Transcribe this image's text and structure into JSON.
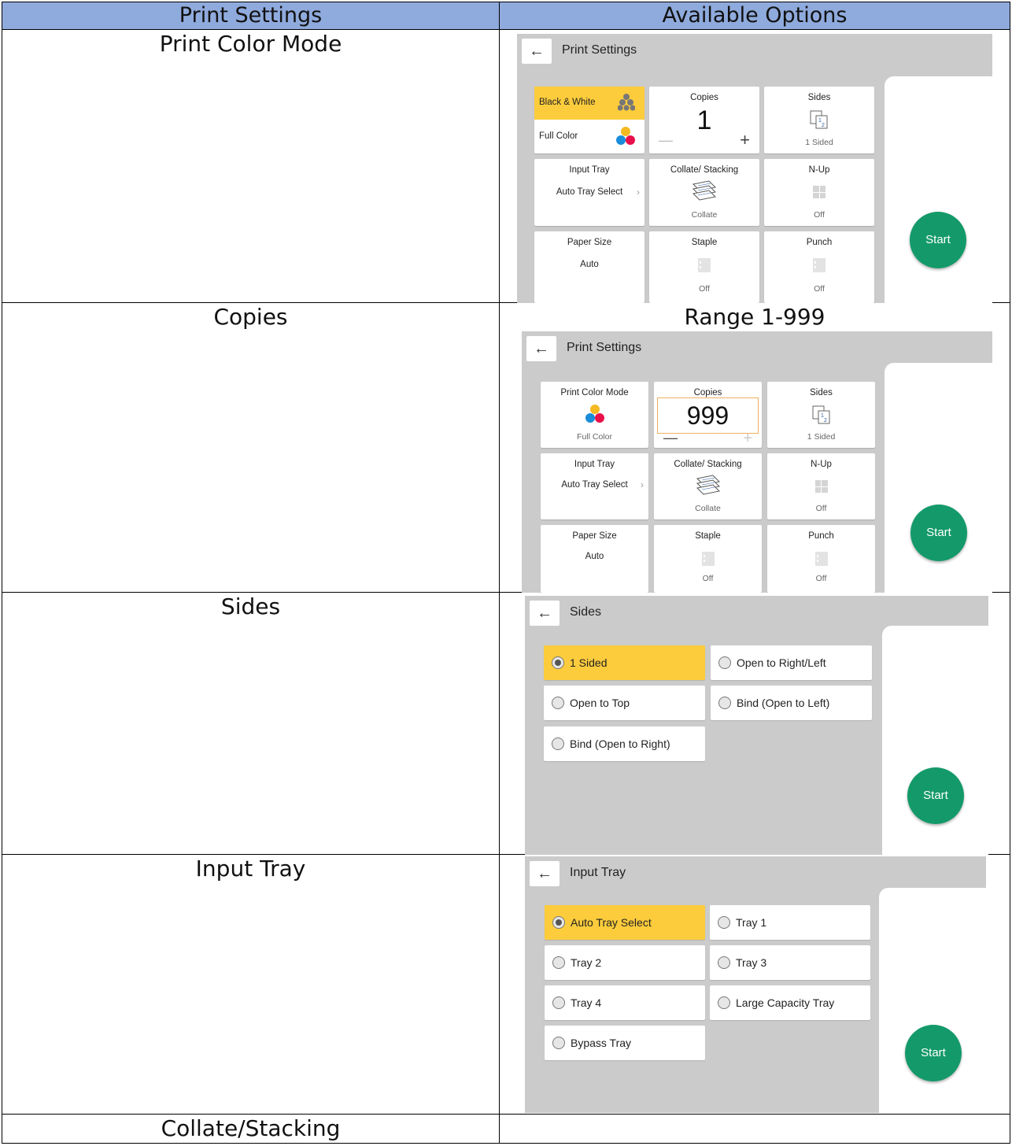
{
  "table": {
    "headers": [
      "Print Settings",
      "Available Options"
    ],
    "rows": [
      {
        "label": "Print Color Mode",
        "note": ""
      },
      {
        "label": "Copies",
        "note": "Range 1-999"
      },
      {
        "label": "Sides",
        "note": ""
      },
      {
        "label": "Input Tray",
        "note": ""
      },
      {
        "label": "Collate/Stacking",
        "note": ""
      }
    ]
  },
  "panel1": {
    "title": "Print Settings",
    "color_options": [
      "Black & White",
      "Full Color"
    ],
    "copies_label": "Copies",
    "copies_value": "1",
    "sides_label": "Sides",
    "sides_value": "1 Sided",
    "input_tray_label": "Input Tray",
    "input_tray_value": "Auto Tray Select",
    "collate_label": "Collate/ Stacking",
    "collate_value": "Collate",
    "nup_label": "N-Up",
    "nup_value": "Off",
    "paper_label": "Paper Size",
    "paper_value": "Auto",
    "staple_label": "Staple",
    "staple_value": "Off",
    "punch_label": "Punch",
    "punch_value": "Off",
    "start": "Start"
  },
  "panel2": {
    "title": "Print Settings",
    "color_label": "Print Color Mode",
    "color_value": "Full Color",
    "copies_label": "Copies",
    "copies_value": "999",
    "sides_label": "Sides",
    "sides_value": "1 Sided",
    "input_tray_label": "Input Tray",
    "input_tray_value": "Auto Tray Select",
    "collate_label": "Collate/ Stacking",
    "collate_value": "Collate",
    "nup_label": "N-Up",
    "nup_value": "Off",
    "paper_label": "Paper Size",
    "paper_value": "Auto",
    "staple_label": "Staple",
    "staple_value": "Off",
    "punch_label": "Punch",
    "punch_value": "Off",
    "start": "Start"
  },
  "panel3": {
    "title": "Sides",
    "options": [
      "1 Sided",
      "Open to Right/Left",
      "Open to Top",
      "Bind (Open to Left)",
      "Bind (Open to Right)"
    ],
    "selected": "1 Sided",
    "start": "Start"
  },
  "panel4": {
    "title": "Input Tray",
    "options": [
      "Auto Tray Select",
      "Tray 1",
      "Tray 2",
      "Tray 3",
      "Tray 4",
      "Large Capacity Tray",
      "Bypass Tray"
    ],
    "selected": "Auto Tray Select",
    "start": "Start"
  },
  "colors": {
    "header_bg": "#8faadc",
    "panel_bg": "#cbcbcb",
    "selected": "#fccc3c",
    "start": "#149a6a"
  }
}
